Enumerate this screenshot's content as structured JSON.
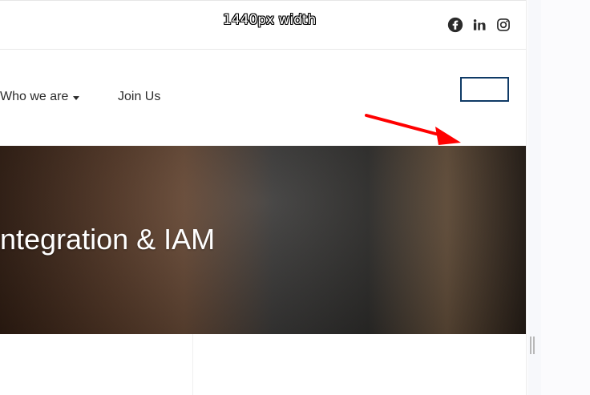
{
  "overlay": {
    "width_label": "1440px width"
  },
  "topbar": {
    "social_icons": [
      "facebook-icon",
      "linkedin-icon",
      "instagram-icon"
    ]
  },
  "nav": {
    "items": [
      {
        "label": "Who we are",
        "has_dropdown": true
      },
      {
        "label": "Join Us",
        "has_dropdown": false
      }
    ]
  },
  "hero": {
    "title": "ntegration & IAM"
  },
  "colors": {
    "arrow": "#ff0000",
    "button_border": "#0f3a66",
    "text": "#2b2b2b",
    "hero_text": "#ffffff"
  }
}
